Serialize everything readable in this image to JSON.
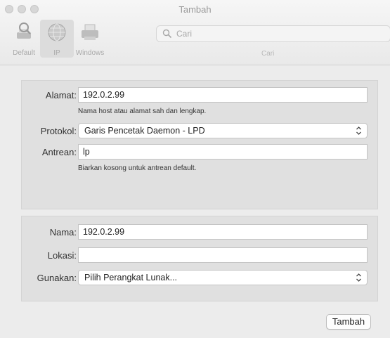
{
  "window": {
    "title": "Tambah"
  },
  "toolbar": {
    "tools": [
      {
        "label": "Default",
        "icon": "printer-default-icon"
      },
      {
        "label": "IP",
        "icon": "globe-ip-icon",
        "selected": true
      },
      {
        "label": "Windows",
        "icon": "windows-printer-icon"
      }
    ],
    "search": {
      "placeholder": "Cari",
      "label": "Cari"
    }
  },
  "printer_panel": {
    "alamat": {
      "label": "Alamat:",
      "value": "192.0.2.99",
      "hint": "Nama host atau alamat sah dan lengkap."
    },
    "protokol": {
      "label": "Protokol:",
      "value": "Garis Pencetak Daemon - LPD"
    },
    "antrean": {
      "label": "Antrean:",
      "value": "lp",
      "hint": "Biarkan kosong untuk antrean default."
    }
  },
  "info_panel": {
    "nama": {
      "label": "Nama:",
      "value": "192.0.2.99"
    },
    "lokasi": {
      "label": "Lokasi:",
      "value": ""
    },
    "gunakan": {
      "label": "Gunakan:",
      "value": "Pilih Perangkat Lunak..."
    }
  },
  "actions": {
    "add_label": "Tambah"
  },
  "colors": {
    "window_bg": "#ececec",
    "panel_bg": "#e0e0e0",
    "toolbar_text": "#a9a9a9"
  }
}
